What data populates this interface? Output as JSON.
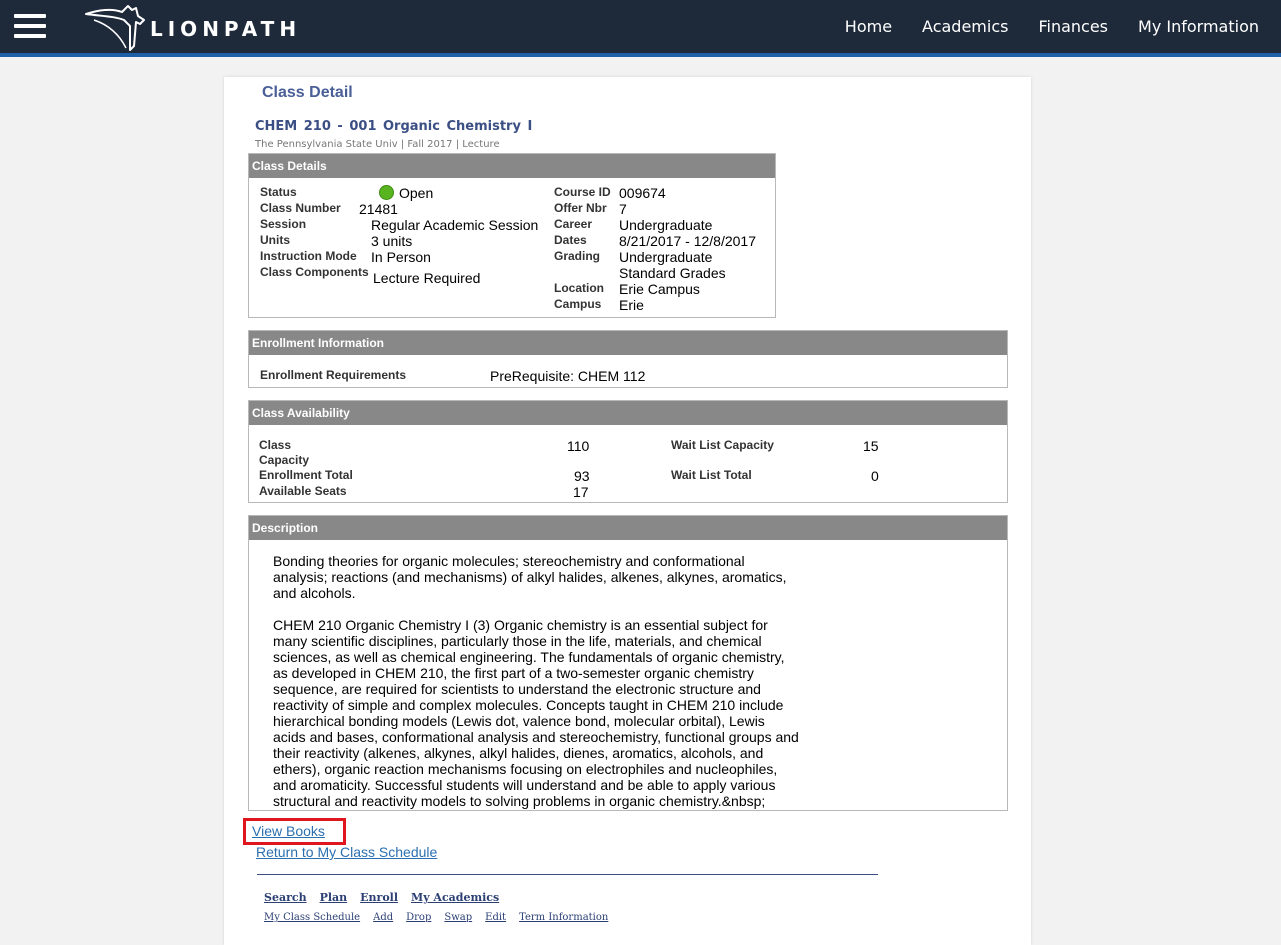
{
  "header": {
    "brand": "LIONPATH",
    "nav": [
      "Home",
      "Academics",
      "Finances",
      "My Information"
    ],
    "colors": {
      "bar": "#1e2a3a",
      "accent": "#1f5fa8"
    }
  },
  "page": {
    "title": "Class Detail",
    "class_heading": "CHEM  210 - 001   Organic Chemistry I",
    "class_sub": "The Pennsylvania State Univ | Fall 2017 | Lecture"
  },
  "class_details": {
    "header": "Class Details",
    "status_label": "Status",
    "status_value": "Open",
    "class_number_label": "Class Number",
    "class_number_value": "21481",
    "session_label": "Session",
    "session_value": "Regular Academic Session",
    "units_label": "Units",
    "units_value": "3 units",
    "instruction_mode_label": "Instruction Mode",
    "instruction_mode_value": "In Person",
    "class_components_label": "Class Components",
    "class_components_value": "Lecture Required",
    "course_id_label": "Course ID",
    "course_id_value": "009674",
    "offer_nbr_label": "Offer Nbr",
    "offer_nbr_value": "7",
    "career_label": "Career",
    "career_value": "Undergraduate",
    "dates_label": "Dates",
    "dates_value": "8/21/2017 - 12/8/2017",
    "grading_label": "Grading",
    "grading_value_1": "Undergraduate",
    "grading_value_2": "Standard Grades",
    "location_label": "Location",
    "location_value": "Erie Campus",
    "campus_label": "Campus",
    "campus_value": "Erie"
  },
  "enrollment": {
    "header": "Enrollment Information",
    "requirements_label": "Enrollment Requirements",
    "requirements_value": "PreRequisite:  CHEM 112"
  },
  "availability": {
    "header": "Class Availability",
    "capacity_label_1": "Class",
    "capacity_label_2": "Capacity",
    "capacity_value": "110",
    "enrollment_total_label": "Enrollment Total",
    "enrollment_total_value": "93",
    "available_seats_label": "Available Seats",
    "available_seats_value": "17",
    "wait_list_capacity_label": "Wait List Capacity",
    "wait_list_capacity_value": "15",
    "wait_list_total_label": "Wait List Total",
    "wait_list_total_value": "0"
  },
  "description": {
    "header": "Description",
    "p1": "Bonding theories for organic molecules; stereochemistry and conformational analysis; reactions (and mechanisms) of alkyl halides, alkenes, alkynes, aromatics, and alcohols.",
    "p2": "CHEM 210 Organic Chemistry I (3) Organic chemistry is an essential subject for many scientific disciplines, particularly those in the life, materials, and chemical sciences, as well as chemical engineering. The fundamentals of organic chemistry, as developed in CHEM 210, the first part of a two-semester organic chemistry sequence, are required for scientists to understand the electronic structure and reactivity of simple and complex molecules. Concepts taught in CHEM 210 include hierarchical bonding models (Lewis dot, valence bond, molecular orbital), Lewis acids and bases, conformational analysis and stereochemistry, functional groups and their reactivity (alkenes, alkynes, alkyl halides, dienes, aromatics, alcohols, and ethers), organic reaction mechanisms focusing on electrophiles and nucleophiles, and aromaticity. Successful students will understand and be able to apply various structural and reactivity models to solving problems in organic chemistry.&nbsp;"
  },
  "links": {
    "view_books": "View Books",
    "return_schedule": "Return to My Class Schedule"
  },
  "footer": {
    "main": [
      "Search",
      "Plan",
      "Enroll",
      "My Academics"
    ],
    "sub": [
      "My Class Schedule",
      "Add",
      "Drop",
      "Swap",
      "Edit",
      "Term Information"
    ]
  }
}
